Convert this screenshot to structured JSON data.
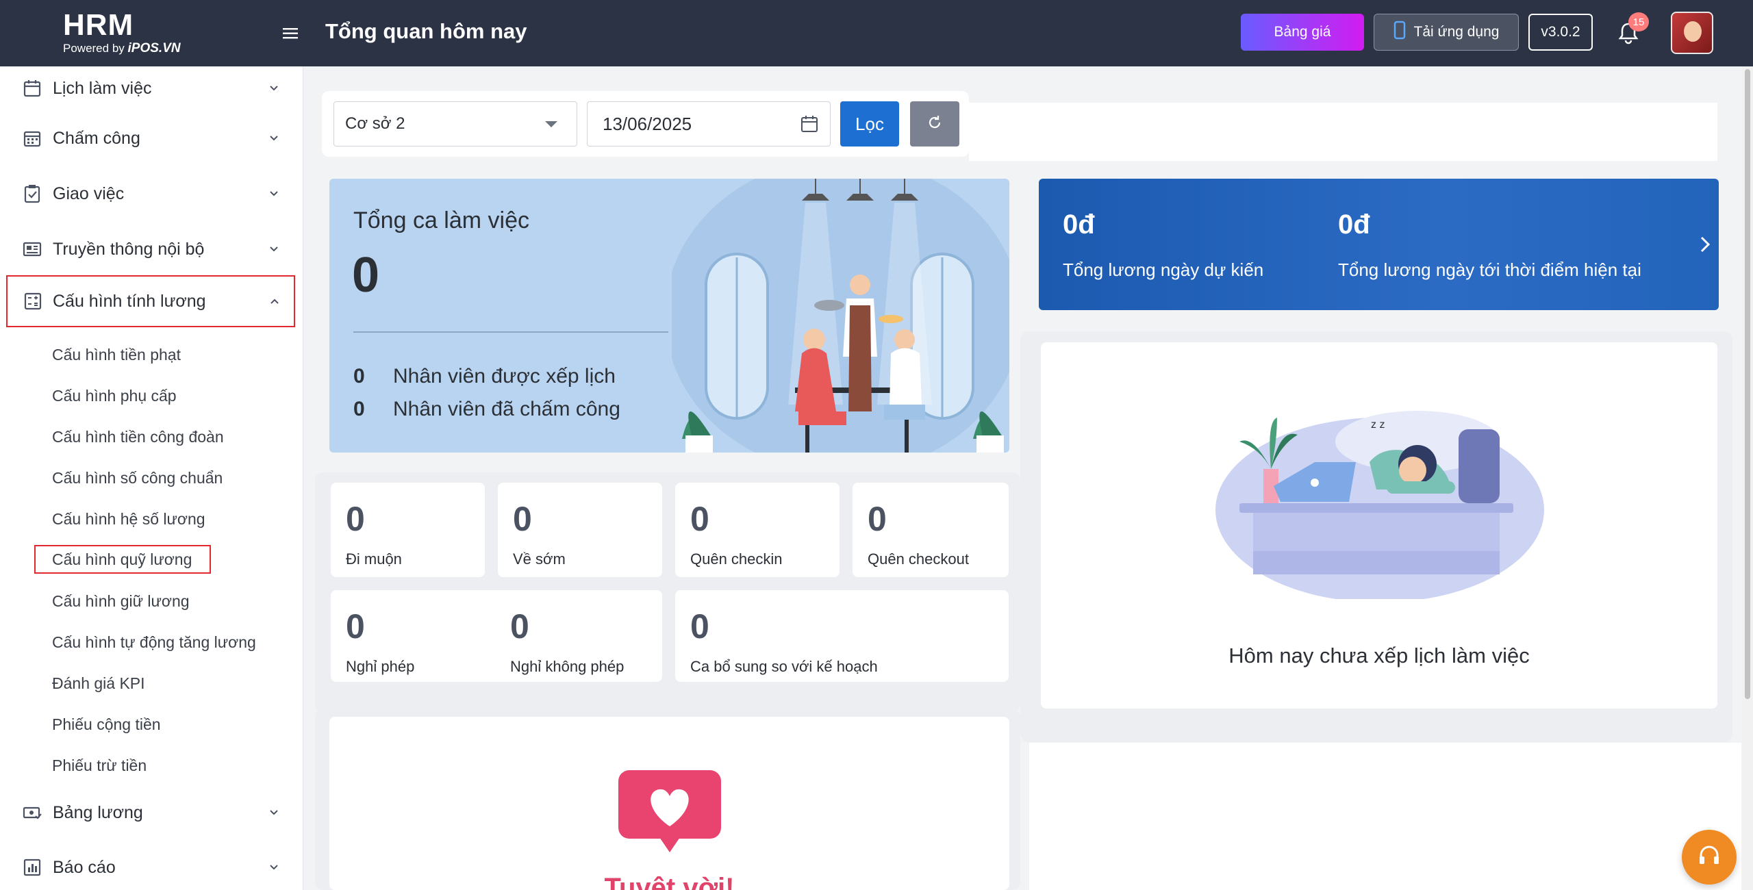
{
  "header": {
    "logo_main": "HRM",
    "logo_powered": "Powered by",
    "logo_brand": "iPOS.VN",
    "page_title": "Tổng quan hôm nay",
    "pricing_label": "Bảng giá",
    "app_label": "Tải ứng dụng",
    "version_label": "v3.0.2",
    "notification_count": "15"
  },
  "sidebar": {
    "items": [
      {
        "label": "Lịch làm việc",
        "icon": "calendar-icon"
      },
      {
        "label": "Chấm công",
        "icon": "calendar-grid-icon"
      },
      {
        "label": "Giao việc",
        "icon": "clipboard-check-icon"
      },
      {
        "label": "Truyền thông nội bộ",
        "icon": "newspaper-icon"
      },
      {
        "label": "Cấu hình tính lương",
        "icon": "calculator-icon"
      },
      {
        "label": "Bảng lương",
        "icon": "money-icon"
      },
      {
        "label": "Báo cáo",
        "icon": "bar-chart-icon"
      }
    ],
    "subitems": [
      "Cấu hình tiền phạt",
      "Cấu hình phụ cấp",
      "Cấu hình tiền công đoàn",
      "Cấu hình số công chuẩn",
      "Cấu hình hệ số lương",
      "Cấu hình quỹ lương",
      "Cấu hình giữ lương",
      "Cấu hình tự động tăng lương",
      "Đánh giá KPI",
      "Phiếu cộng tiền",
      "Phiếu trừ tiền"
    ]
  },
  "filters": {
    "branch_value": "Cơ sở 2",
    "date_value": "13/06/2025",
    "filter_label": "Lọc"
  },
  "shift_card": {
    "title": "Tổng ca làm việc",
    "total": "0",
    "scheduled_count": "0",
    "scheduled_label": "Nhân viên được xếp lịch",
    "checked_count": "0",
    "checked_label": "Nhân viên đã chấm công"
  },
  "salary_card": {
    "expected_value": "0đ",
    "expected_label": "Tổng lương ngày dự kiến",
    "current_value": "0đ",
    "current_label": "Tổng lương ngày tới thời điểm hiện tại"
  },
  "stats": [
    {
      "value": "0",
      "label": "Đi muộn"
    },
    {
      "value": "0",
      "label": "Về sớm"
    },
    {
      "value": "0",
      "label": "Quên checkin"
    },
    {
      "value": "0",
      "label": "Quên checkout"
    },
    {
      "value": "0",
      "label": "Nghỉ phép"
    },
    {
      "value": "0",
      "label": "Nghỉ không phép"
    },
    {
      "value": "0",
      "label": "Ca bổ sung so với kế hoạch"
    }
  ],
  "schedule": {
    "empty_text": "Hôm nay chưa xếp lịch làm việc"
  },
  "bottom_card": {
    "text": "Tuyệt vời!"
  },
  "colors": {
    "header_bg": "#2b3345",
    "primary": "#1d6fd1",
    "active_border": "#e0282e",
    "support": "#f08a22"
  }
}
